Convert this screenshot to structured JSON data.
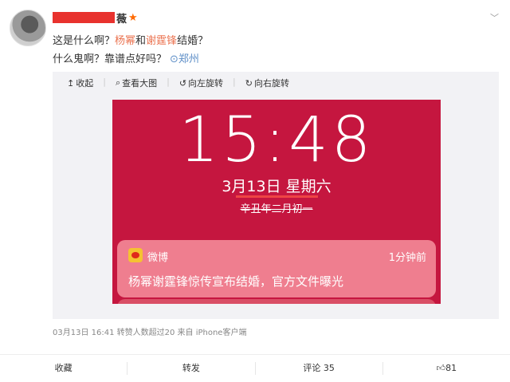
{
  "post": {
    "author_tail": "薇",
    "line1_prefix": "这是什么啊？",
    "tag1": "杨幂",
    "and": "和",
    "tag2": "谢霆锋",
    "line1_suffix": "结婚？",
    "line2": "什么鬼啊？靠谱点好吗？",
    "location": "郑州"
  },
  "toolbar": {
    "collapse": "收起",
    "view_large": "查看大图",
    "rotate_left": "向左旋转",
    "rotate_right": "向右旋转"
  },
  "lockscreen": {
    "time": "15:48",
    "date": "3月13日 星期六",
    "lunar": "辛丑年二月初一",
    "notification": {
      "app": "微博",
      "time": "1分钟前",
      "message": "杨幂谢霆锋惊传宣布结婚，官方文件曝光"
    }
  },
  "meta": "03月13日 16:41 转赞人数超过20 来自 iPhone客户端",
  "actions": {
    "favorite": "收藏",
    "repost": "转发",
    "comment": "评论 35",
    "like": "81"
  },
  "colors": {
    "accent": "#eb7350",
    "lockscreen_bg": "#c5163f",
    "redact": "#e8322e"
  }
}
